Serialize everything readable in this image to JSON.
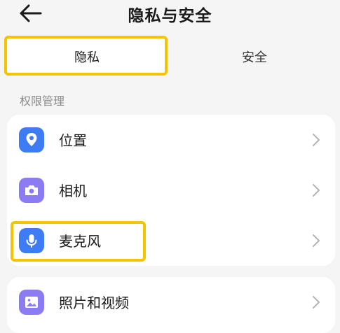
{
  "header": {
    "title": "隐私与安全",
    "back_icon": "arrow-left-icon"
  },
  "tabs": [
    {
      "label": "隐私",
      "selected": true
    },
    {
      "label": "安全",
      "selected": false
    }
  ],
  "section": {
    "label": "权限管理"
  },
  "permissions": [
    {
      "label": "位置",
      "icon": "location-icon",
      "color": "#3d7cf4"
    },
    {
      "label": "相机",
      "icon": "camera-icon",
      "color": "#8b7cf4"
    },
    {
      "label": "麦克风",
      "icon": "microphone-icon",
      "color": "#3d7cf4"
    }
  ],
  "media": [
    {
      "label": "照片和视频",
      "icon": "photo-icon",
      "color": "#8b7cf4"
    }
  ],
  "highlight_color": "#f5c400"
}
